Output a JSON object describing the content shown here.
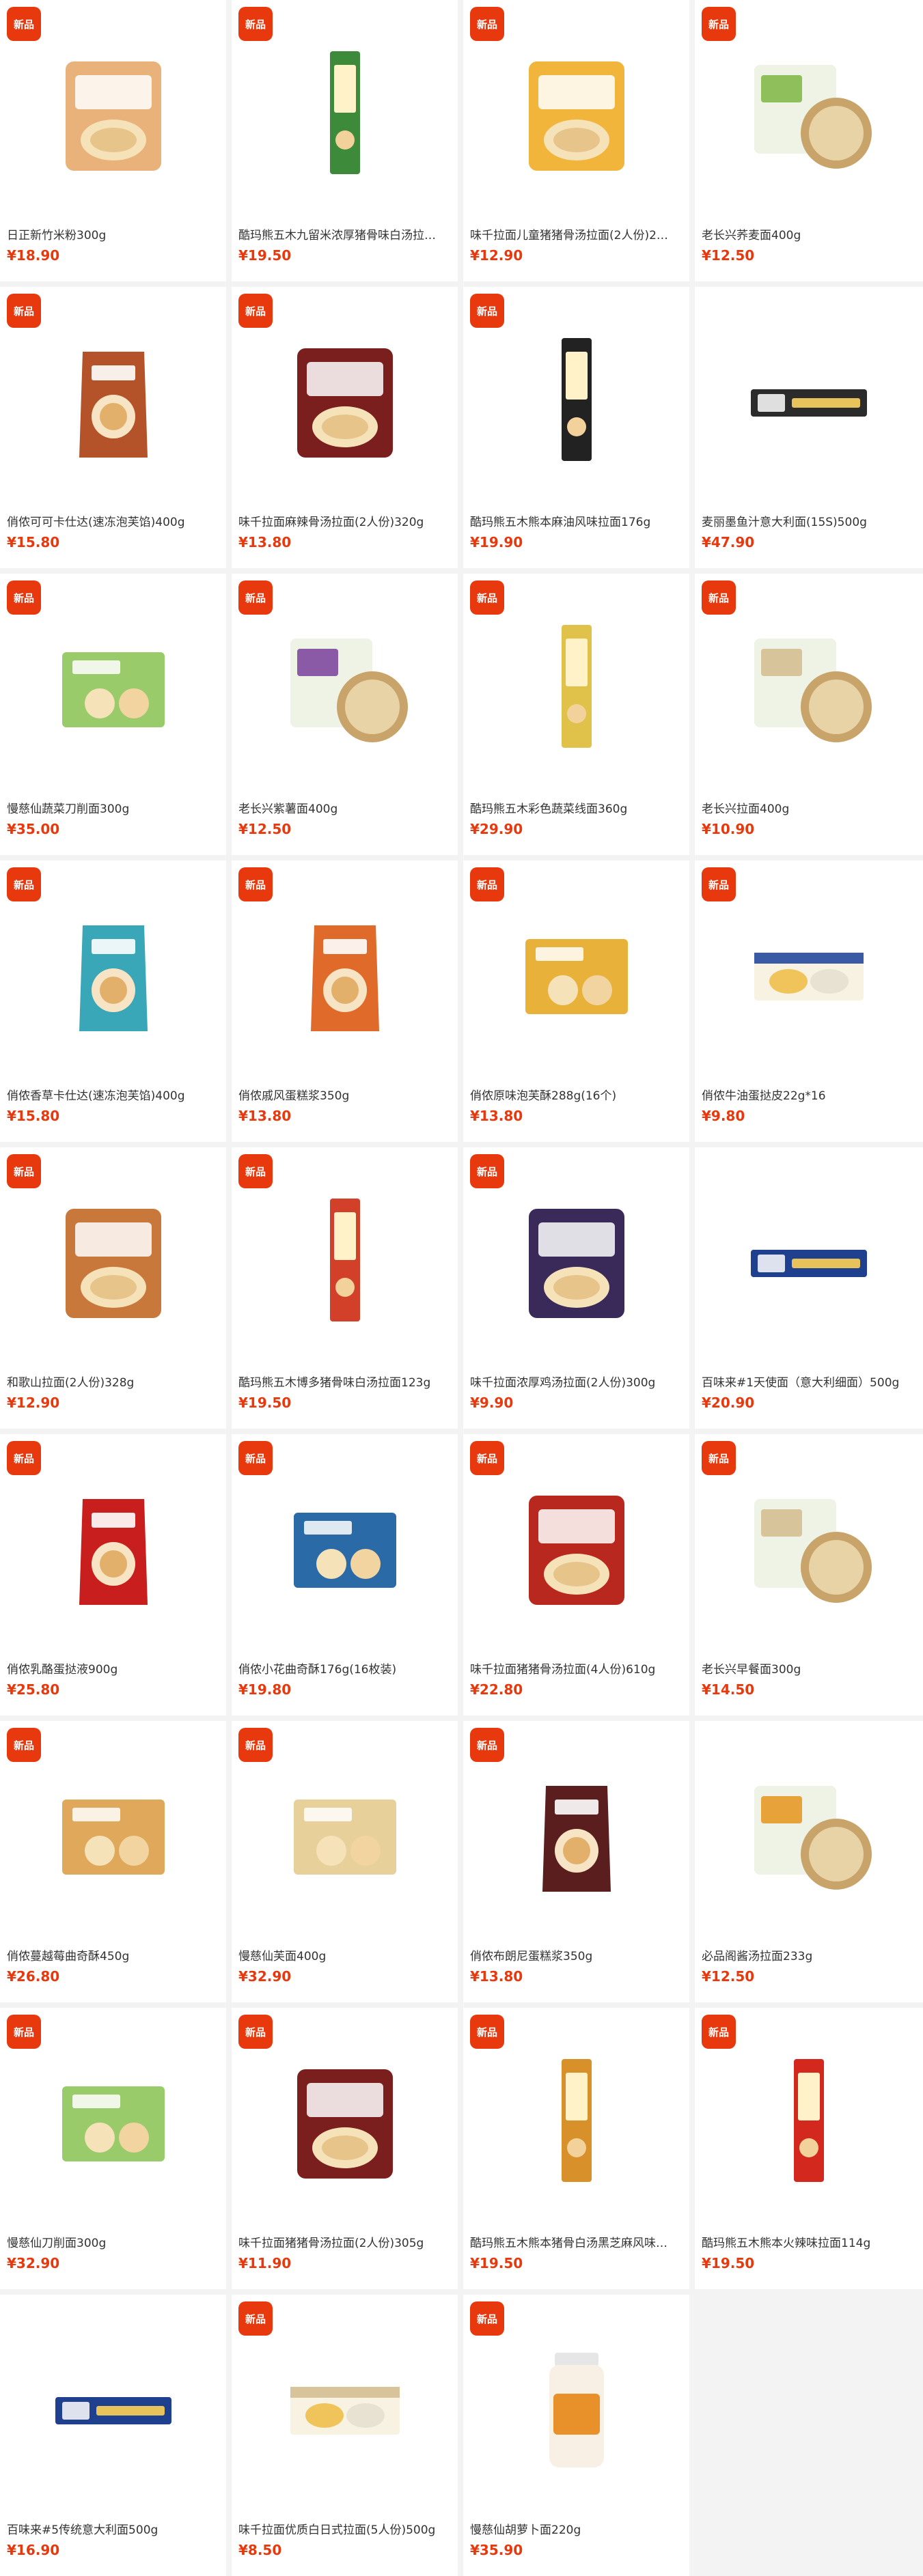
{
  "badge_text": "新品",
  "colors": {
    "badge": "#e8380d",
    "price": "#e8380d",
    "background": "#f3f3f3",
    "card": "#ffffff"
  },
  "products": [
    {
      "name": "日正新竹米粉300g",
      "price": "¥18.90",
      "badge": true,
      "icon": "rice-noodle-bag-icon",
      "color": "#e9b27a",
      "shape": "bag"
    },
    {
      "name": "酷玛熊五木九留米浓厚猪骨味白汤拉…",
      "price": "¥19.50",
      "badge": true,
      "icon": "ramen-pack-icon",
      "color": "#3c8a3a",
      "shape": "tall"
    },
    {
      "name": "味千拉面儿童猪猪骨汤拉面(2人份)2…",
      "price": "¥12.90",
      "badge": true,
      "icon": "panda-ramen-pack-icon",
      "color": "#f0b53a",
      "shape": "bag"
    },
    {
      "name": "老长兴荞麦面400g",
      "price": "¥12.50",
      "badge": true,
      "icon": "soba-pack-icon",
      "color": "#8fbf5a",
      "shape": "bowl"
    },
    {
      "name": "俏侬可可卡仕达(速冻泡芙馅)400g",
      "price": "¥15.80",
      "badge": true,
      "icon": "custard-pouch-icon",
      "color": "#b4532a",
      "shape": "pouch"
    },
    {
      "name": "味千拉面麻辣骨汤拉面(2人份)320g",
      "price": "¥13.80",
      "badge": true,
      "icon": "spicy-ramen-pack-icon",
      "color": "#7b1e1e",
      "shape": "bag"
    },
    {
      "name": "酷玛熊五木熊本麻油风味拉面176g",
      "price": "¥19.90",
      "badge": true,
      "icon": "kumamon-ramen-pack-icon",
      "color": "#222222",
      "shape": "tall"
    },
    {
      "name": "麦丽墨鱼汁意大利面(15S)500g",
      "price": "¥47.90",
      "badge": false,
      "icon": "squid-ink-pasta-icon",
      "color": "#2b2b2b",
      "shape": "stick"
    },
    {
      "name": "慢慈仙蔬菜刀削面300g",
      "price": "¥35.00",
      "badge": true,
      "icon": "vegetable-noodle-pack-icon",
      "color": "#9acb6a",
      "shape": "box"
    },
    {
      "name": "老长兴紫薯面400g",
      "price": "¥12.50",
      "badge": true,
      "icon": "purple-noodle-pack-icon",
      "color": "#8a5aa6",
      "shape": "bowl"
    },
    {
      "name": "酷玛熊五木彩色蔬菜线面360g",
      "price": "¥29.90",
      "badge": true,
      "icon": "colorful-noodle-pack-icon",
      "color": "#e0c24a",
      "shape": "tall"
    },
    {
      "name": "老长兴拉面400g",
      "price": "¥10.90",
      "badge": true,
      "icon": "noodle-pack-icon",
      "color": "#d8c49a",
      "shape": "bowl"
    },
    {
      "name": "俏侬香草卡仕达(速冻泡芙馅)400g",
      "price": "¥15.80",
      "badge": true,
      "icon": "vanilla-custard-pouch-icon",
      "color": "#3aa7b8",
      "shape": "pouch"
    },
    {
      "name": "俏侬戚风蛋糕浆350g",
      "price": "¥13.80",
      "badge": true,
      "icon": "chiffon-pouch-icon",
      "color": "#e06a2a",
      "shape": "pouch"
    },
    {
      "name": "俏侬原味泡芙酥288g(16个)",
      "price": "¥13.80",
      "badge": true,
      "icon": "puff-box-icon",
      "color": "#e8b23a",
      "shape": "box"
    },
    {
      "name": "俏侬牛油蛋挞皮22g*16",
      "price": "¥9.80",
      "badge": true,
      "icon": "tart-shell-box-icon",
      "color": "#3a5aa6",
      "shape": "flatbox"
    },
    {
      "name": "和歌山拉面(2人份)328g",
      "price": "¥12.90",
      "badge": true,
      "icon": "wakayama-ramen-pack-icon",
      "color": "#c8783a",
      "shape": "bag"
    },
    {
      "name": "酷玛熊五木博多猪骨味白汤拉面123g",
      "price": "¥19.50",
      "badge": true,
      "icon": "hakata-ramen-pack-icon",
      "color": "#d2402a",
      "shape": "tall"
    },
    {
      "name": "味千拉面浓厚鸡汤拉面(2人份)300g",
      "price": "¥9.90",
      "badge": true,
      "icon": "chicken-ramen-pack-icon",
      "color": "#3a2a5a",
      "shape": "bag"
    },
    {
      "name": "百味来#1天使面（意大利细面）500g",
      "price": "¥20.90",
      "badge": false,
      "icon": "angel-hair-pasta-box-icon",
      "color": "#1f3f8f",
      "shape": "stick"
    },
    {
      "name": "俏侬乳酪蛋挞液900g",
      "price": "¥25.80",
      "badge": true,
      "icon": "egg-tart-liquid-pouch-icon",
      "color": "#c81e1e",
      "shape": "pouch"
    },
    {
      "name": "俏侬小花曲奇酥176g(16枚装)",
      "price": "¥19.80",
      "badge": true,
      "icon": "cookie-box-icon",
      "color": "#2a6aa6",
      "shape": "box"
    },
    {
      "name": "味千拉面猪猪骨汤拉面(4人份)610g",
      "price": "¥22.80",
      "badge": true,
      "icon": "pork-ramen-pack-icon",
      "color": "#b8281e",
      "shape": "bag"
    },
    {
      "name": "老长兴早餐面300g",
      "price": "¥14.50",
      "badge": true,
      "icon": "breakfast-noodle-pack-icon",
      "color": "#d8c49a",
      "shape": "bowl"
    },
    {
      "name": "俏侬蔓越莓曲奇酥450g",
      "price": "¥26.80",
      "badge": true,
      "icon": "cranberry-cookie-icon",
      "color": "#e0a85a",
      "shape": "box"
    },
    {
      "name": "慢慈仙芙面400g",
      "price": "¥32.90",
      "badge": true,
      "icon": "fu-noodle-box-icon",
      "color": "#e8d09a",
      "shape": "box"
    },
    {
      "name": "俏侬布朗尼蛋糕浆350g",
      "price": "¥13.80",
      "badge": true,
      "icon": "brownie-pouch-icon",
      "color": "#5a1e1e",
      "shape": "pouch"
    },
    {
      "name": "必品阁酱汤拉面233g",
      "price": "¥12.50",
      "badge": false,
      "icon": "ramen-bowl-icon",
      "color": "#e8a23a",
      "shape": "bowl"
    },
    {
      "name": "慢慈仙刀削面300g",
      "price": "¥32.90",
      "badge": true,
      "icon": "knife-cut-noodle-pack-icon",
      "color": "#9acb6a",
      "shape": "box"
    },
    {
      "name": "味千拉面猪猪骨汤拉面(2人份)305g",
      "price": "¥11.90",
      "badge": true,
      "icon": "tonkotsu-ramen-pack-icon",
      "color": "#7b1e1e",
      "shape": "bag"
    },
    {
      "name": "酷玛熊五木熊本猪骨白汤黑芝麻风味…",
      "price": "¥19.50",
      "badge": true,
      "icon": "black-sesame-ramen-pack-icon",
      "color": "#d8902a",
      "shape": "tall"
    },
    {
      "name": "酷玛熊五木熊本火辣味拉面114g",
      "price": "¥19.50",
      "badge": true,
      "icon": "spicy-kumamon-ramen-pack-icon",
      "color": "#d2281e",
      "shape": "tall"
    },
    {
      "name": "百味来#5传统意大利面500g",
      "price": "¥16.90",
      "badge": false,
      "icon": "spaghetti-box-icon",
      "color": "#1f3f8f",
      "shape": "stick"
    },
    {
      "name": "味千拉面优质白日式拉面(5人份)500g",
      "price": "¥8.50",
      "badge": true,
      "icon": "japanese-ramen-pack-icon",
      "color": "#d8c49a",
      "shape": "flatbox"
    },
    {
      "name": "慢慈仙胡萝卜面220g",
      "price": "¥35.90",
      "badge": true,
      "icon": "carrot-noodle-jar-icon",
      "color": "#e8902a",
      "shape": "jar"
    }
  ]
}
